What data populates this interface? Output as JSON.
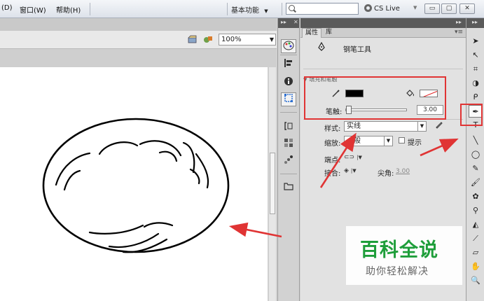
{
  "menu": {
    "items": [
      "(D)",
      "窗口(W)",
      "帮助(H)"
    ],
    "workspace": "基本功能",
    "search_placeholder": "",
    "cs_live": "CS Live",
    "window_buttons": [
      "▭",
      "▢",
      "✕"
    ]
  },
  "doc": {
    "zoom": "100%"
  },
  "panel": {
    "tabs": [
      "属性",
      "库"
    ],
    "tool_name": "钢笔工具",
    "section_title": "填充和笔触",
    "stroke_label": "笔触:",
    "stroke_value": "3.00",
    "stroke_level": 0.03,
    "stroke_color": "#000000",
    "style_label": "样式:",
    "style_value": "实线",
    "scale_label": "缩放:",
    "scale_value": "一般",
    "hint_label": "提示",
    "cap_label": "端点:",
    "join_label": "接合:",
    "miter_label": "尖角:",
    "miter_value": "3.00"
  },
  "annotations": {
    "color": "#e03434"
  },
  "watermark": {
    "title": "百科全说",
    "subtitle": "助你轻松解决",
    "color": "#1e9e3a"
  }
}
